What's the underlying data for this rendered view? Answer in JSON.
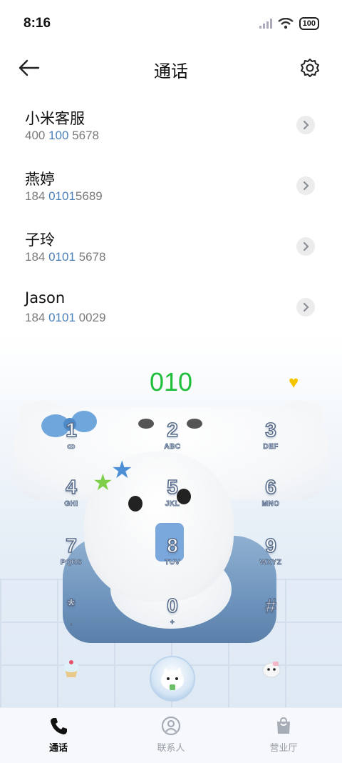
{
  "status": {
    "time": "8:16",
    "battery": "100"
  },
  "header": {
    "title": "通话",
    "back_icon": "arrow-left-icon",
    "settings_icon": "gear-icon"
  },
  "contacts": [
    {
      "name": "小米客服",
      "num_pre": "400 ",
      "num_hl": "100",
      "num_post": " 5678"
    },
    {
      "name": "燕婷",
      "num_pre": "184 ",
      "num_hl": "0101",
      "num_post": "5689"
    },
    {
      "name": "子玲",
      "num_pre": "184 ",
      "num_hl": "0101",
      "num_post": " 5678"
    },
    {
      "name": "Jason",
      "num_pre": "184 ",
      "num_hl": "0101",
      "num_post": " 0029"
    }
  ],
  "dialer": {
    "input": "010",
    "keys": [
      {
        "digit": "1",
        "letters": "ꝏ"
      },
      {
        "digit": "2",
        "letters": "ABC"
      },
      {
        "digit": "3",
        "letters": "DEF"
      },
      {
        "digit": "4",
        "letters": "GHI"
      },
      {
        "digit": "5",
        "letters": "JKL"
      },
      {
        "digit": "6",
        "letters": "MNO"
      },
      {
        "digit": "7",
        "letters": "PQRS"
      },
      {
        "digit": "8",
        "letters": "TUV"
      },
      {
        "digit": "9",
        "letters": "WXYZ"
      },
      {
        "digit": "*",
        "letters": ","
      },
      {
        "digit": "0",
        "letters": "+"
      },
      {
        "digit": "#",
        "letters": ""
      }
    ]
  },
  "nav": {
    "tabs": [
      {
        "label": "通话",
        "icon": "phone-icon",
        "active": true
      },
      {
        "label": "联系人",
        "icon": "contacts-icon",
        "active": false
      },
      {
        "label": "营业厅",
        "icon": "shopping-bag-icon",
        "active": false
      }
    ]
  },
  "colors": {
    "dialed_green": "#1fbf3b",
    "highlight_blue": "#4b7fb8",
    "heart_yellow": "#f5c400"
  }
}
